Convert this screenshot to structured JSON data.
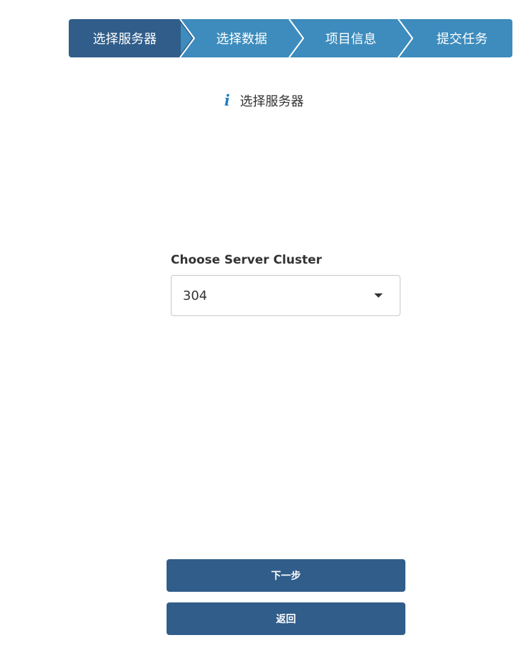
{
  "stepper": {
    "steps": [
      {
        "label": "选择服务器",
        "state": "active"
      },
      {
        "label": "选择数据",
        "state": "inactive"
      },
      {
        "label": "项目信息",
        "state": "inactive"
      },
      {
        "label": "提交任务",
        "state": "inactive"
      }
    ],
    "colors": {
      "active": "#305d8a",
      "inactive": "#3d8cbd"
    }
  },
  "info": {
    "icon": "info-icon",
    "glyph": "i",
    "text": "选择服务器"
  },
  "form": {
    "server_cluster": {
      "label": "Choose Server Cluster",
      "value": "304",
      "caret_icon": "caret-down-icon"
    }
  },
  "actions": {
    "next_label": "下一步",
    "back_label": "返回",
    "color": "#305d8a"
  }
}
